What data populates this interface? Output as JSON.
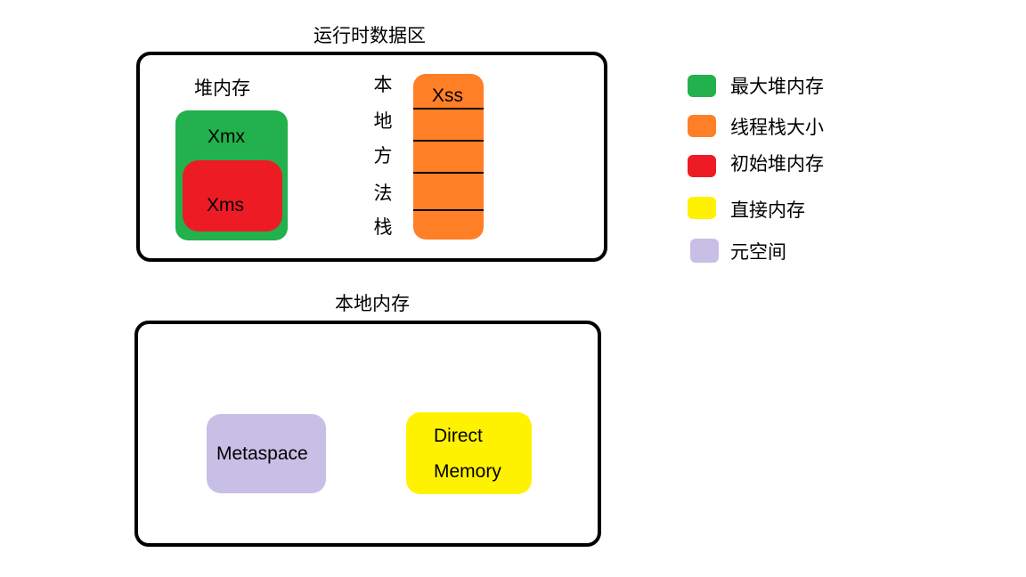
{
  "runtime_area": {
    "title": "运行时数据区",
    "heap": {
      "label": "堆内存",
      "max_label": "Xmx",
      "initial_label": "Xms"
    },
    "native_method_stack": {
      "label_chars": [
        "本",
        "地",
        "方",
        "法",
        "栈"
      ]
    },
    "thread_stack": {
      "label": "Xss",
      "segments": 5
    }
  },
  "native_memory": {
    "title": "本地内存",
    "metaspace_label": "Metaspace",
    "direct_memory_lines": [
      "Direct",
      "Memory"
    ]
  },
  "legend": {
    "items": [
      {
        "label": "最大堆内存",
        "color": "#22b14c"
      },
      {
        "label": "线程栈大小",
        "color": "#ff7f27"
      },
      {
        "label": "初始堆内存",
        "color": "#ed1c24"
      },
      {
        "label": "直接内存",
        "color": "#fff200"
      },
      {
        "label": "元空间",
        "color": "#c8bfe7"
      }
    ]
  },
  "colors": {
    "heap_max": "#22b14c",
    "heap_initial": "#ed1c24",
    "thread_stack": "#ff7f27",
    "metaspace": "#c8bfe7",
    "direct_memory": "#fff200",
    "frame": "#000000"
  }
}
